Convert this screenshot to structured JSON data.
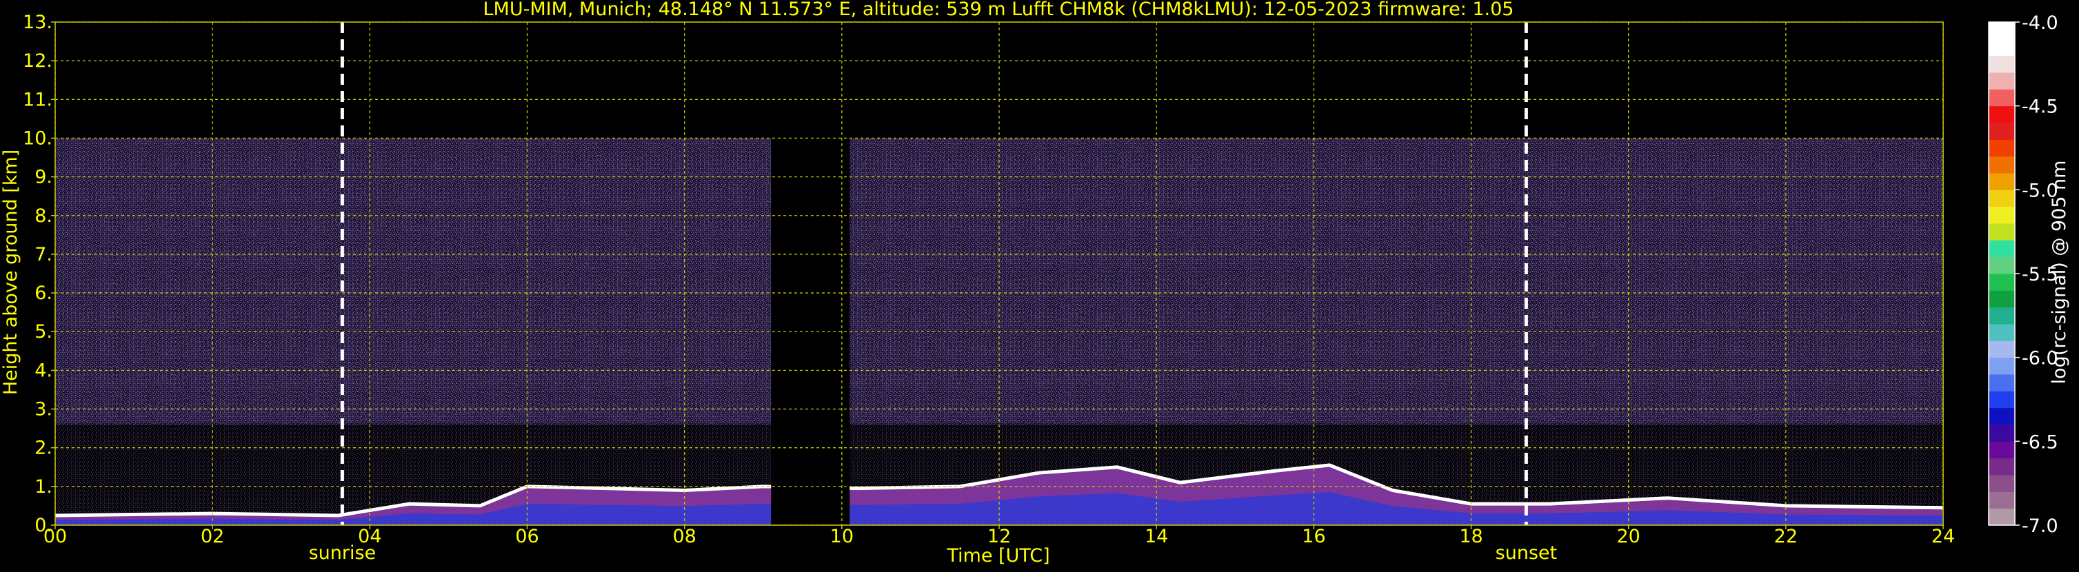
{
  "chart_data": {
    "type": "heatmap",
    "title": "LMU-MIM, Munich; 48.148° N 11.573° E, altitude: 539 m    Lufft CHM8k (CHM8kLMU): 12-05-2023    firmware: 1.05",
    "xlabel": "Time [UTC]",
    "ylabel": "Height above ground [km]",
    "x_ticks": [
      "00",
      "02",
      "04",
      "06",
      "08",
      "10",
      "12",
      "14",
      "16",
      "18",
      "20",
      "22",
      "24"
    ],
    "y_ticks": [
      "0.",
      "1.",
      "2.",
      "3.",
      "4.",
      "5.",
      "6.",
      "7.",
      "8.",
      "9.",
      "10.",
      "11.",
      "12.",
      "13."
    ],
    "xlim": [
      0,
      24
    ],
    "ylim": [
      0,
      13
    ],
    "grid": true,
    "sunrise_time": 3.65,
    "sunset_time": 18.7,
    "sunrise_label": "sunrise",
    "sunset_label": "sunset",
    "signal_top_km": 10,
    "data_gaps": [
      [
        9.1,
        10.1
      ]
    ],
    "cloud_base_km": [
      {
        "x": 0.0,
        "y": 0.25
      },
      {
        "x": 2.0,
        "y": 0.3
      },
      {
        "x": 3.6,
        "y": 0.25
      },
      {
        "x": 4.5,
        "y": 0.55
      },
      {
        "x": 5.4,
        "y": 0.5
      },
      {
        "x": 6.0,
        "y": 1.0
      },
      {
        "x": 7.0,
        "y": 0.95
      },
      {
        "x": 8.0,
        "y": 0.9
      },
      {
        "x": 9.0,
        "y": 1.0
      },
      {
        "x": 10.2,
        "y": 0.95
      },
      {
        "x": 11.5,
        "y": 1.0
      },
      {
        "x": 12.5,
        "y": 1.35
      },
      {
        "x": 13.5,
        "y": 1.5
      },
      {
        "x": 14.3,
        "y": 1.1
      },
      {
        "x": 15.5,
        "y": 1.4
      },
      {
        "x": 16.2,
        "y": 1.55
      },
      {
        "x": 17.0,
        "y": 0.9
      },
      {
        "x": 18.0,
        "y": 0.55
      },
      {
        "x": 19.0,
        "y": 0.55
      },
      {
        "x": 20.5,
        "y": 0.7
      },
      {
        "x": 22.0,
        "y": 0.5
      },
      {
        "x": 24.0,
        "y": 0.45
      }
    ],
    "colorbar": {
      "label": "log(rc-signal) @ 905 nm",
      "ticks": [
        "-4.0",
        "-4.5",
        "-5.0",
        "-5.5",
        "-6.0",
        "-6.5",
        "-7.0"
      ],
      "range": [
        -7.0,
        -4.0
      ],
      "colors": [
        "#b09aa8",
        "#9a6f93",
        "#8b4f8a",
        "#7a2a8a",
        "#6a0a9a",
        "#3a0aa0",
        "#1010c0",
        "#2040f0",
        "#4a70f0",
        "#7ea0f0",
        "#a6b8f0",
        "#4ec0c0",
        "#20b090",
        "#10a040",
        "#20c050",
        "#60d080",
        "#30e0a0",
        "#c0e020",
        "#f0f020",
        "#f0d010",
        "#f0a000",
        "#f07000",
        "#f04000",
        "#e02020",
        "#f01010",
        "#f06060",
        "#f0b0b0",
        "#f0e0e0",
        "#ffffff",
        "#ffffff"
      ]
    }
  }
}
